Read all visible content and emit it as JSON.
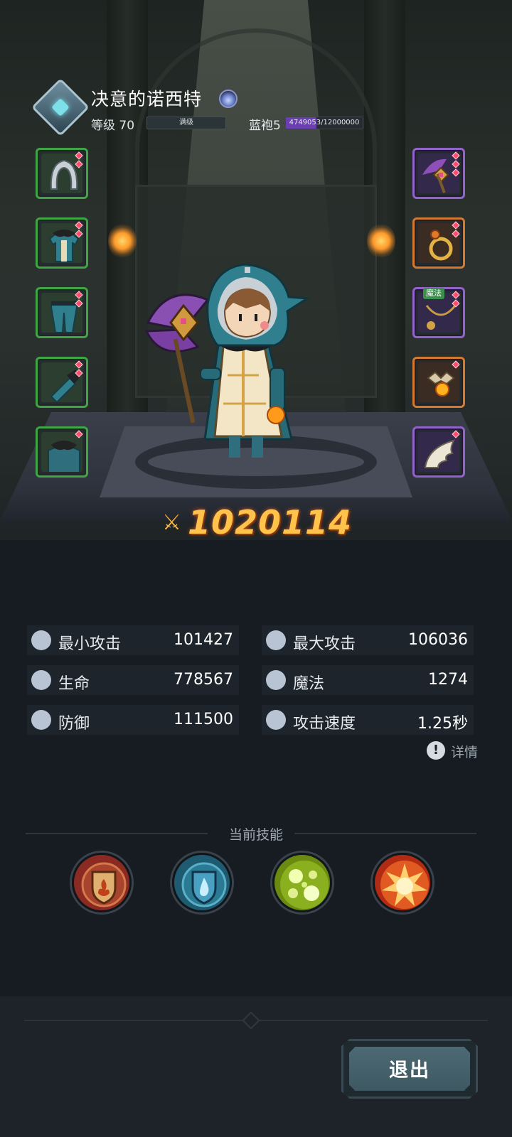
{
  "character": {
    "name": "决意的诺西特",
    "level_text": "等级 70",
    "level_bar_label": "满级",
    "robe_label": "蓝袍5",
    "exp_text": "4749053/12000000",
    "exp_progress": 0.396
  },
  "equipment": {
    "left": [
      {
        "name": "hood",
        "quality": "green"
      },
      {
        "name": "armor",
        "quality": "green"
      },
      {
        "name": "pants",
        "quality": "green"
      },
      {
        "name": "gloves",
        "quality": "green"
      },
      {
        "name": "cloak",
        "quality": "green"
      }
    ],
    "right": [
      {
        "name": "staff",
        "quality": "purple"
      },
      {
        "name": "ring",
        "quality": "orange"
      },
      {
        "name": "necklace",
        "quality": "purple",
        "tag": "魔法"
      },
      {
        "name": "amulet",
        "quality": "orange"
      },
      {
        "name": "wing-charm",
        "quality": "purple"
      }
    ]
  },
  "power": {
    "value": "1020114"
  },
  "stats": [
    {
      "label": "最小攻击",
      "value": "101427",
      "icon": "sword-icon"
    },
    {
      "label": "最大攻击",
      "value": "106036",
      "icon": "sword-icon"
    },
    {
      "label": "生命",
      "value": "778567",
      "icon": "heart-icon"
    },
    {
      "label": "魔法",
      "value": "1274",
      "icon": "magic-swirl-icon"
    },
    {
      "label": "防御",
      "value": "111500",
      "icon": "shield-icon"
    },
    {
      "label": "攻击速度",
      "value": "1.25秒",
      "icon": "speed-icon"
    }
  ],
  "detail_label": "详情",
  "skills": {
    "title": "当前技能",
    "items": [
      {
        "name": "flame-shield-skill"
      },
      {
        "name": "water-shield-skill"
      },
      {
        "name": "poison-bubbles-skill"
      },
      {
        "name": "explosion-skill"
      }
    ]
  },
  "exit_label": "退出",
  "colors": {
    "quality_green": "#3fa547",
    "quality_orange": "#d07a34",
    "quality_purple": "#9064c9",
    "power_gold": "#ffc24a",
    "exp_purple": "#6b3fb3"
  }
}
